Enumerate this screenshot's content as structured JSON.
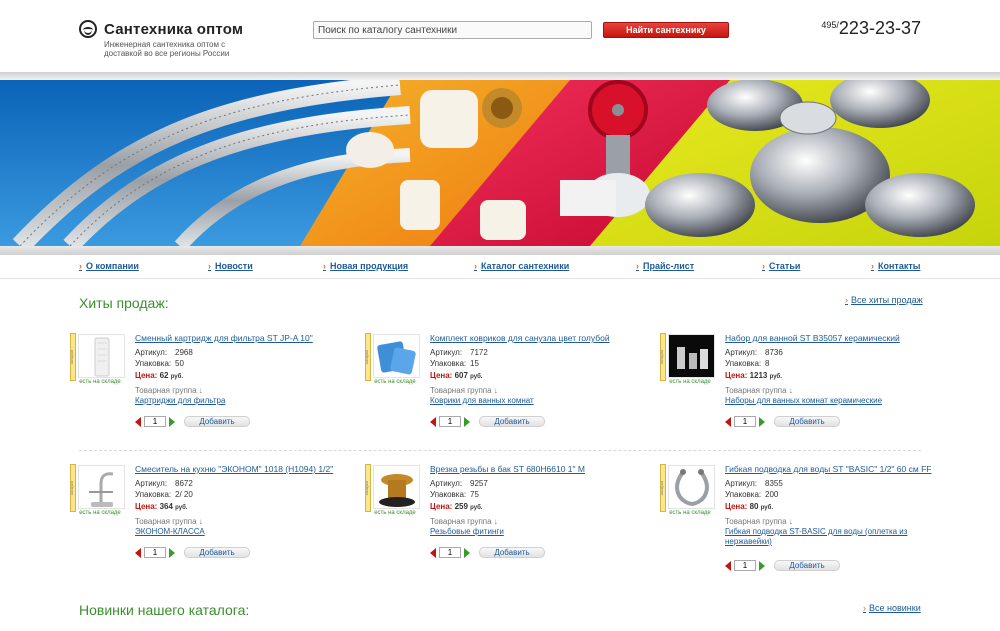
{
  "header": {
    "logo_title": "Сантехника оптом",
    "tagline": "Инженерная сантехника оптом с доставкой во все регионы России",
    "search_placeholder": "Поиск по каталогу сантехники",
    "search_button": "Найти сантехнику",
    "phone_code": "495/",
    "phone_number": "223-23-37"
  },
  "nav": [
    "О компании",
    "Новости",
    "Новая продукция",
    "Каталог сантехники",
    "Прайс-лист",
    "Статьи",
    "Контакты"
  ],
  "hits": {
    "title": "Хиты продаж:",
    "all_link": "Все хиты продаж"
  },
  "new": {
    "title": "Новинки нашего каталога:",
    "all_link": "Все новинки"
  },
  "labels": {
    "sku": "Артикул:",
    "pack": "Упаковка:",
    "price": "Цена:",
    "currency": "руб.",
    "group": "Товарная группа ↓",
    "in_stock": "есть на складе",
    "rating": "рейтинг",
    "add": "Добавить",
    "qty": "1"
  },
  "products": [
    {
      "name": "Сменный картридж для фильтра ST JP-A 10\"",
      "sku": "2968",
      "pack": "50",
      "price": "62",
      "group": "Картриджи для фильтра",
      "image": "filter-cartridge"
    },
    {
      "name": "Комплект ковриков для санузла цвет голубой",
      "sku": "7172",
      "pack": "15",
      "price": "607",
      "group": "Коврики для ванных комнат",
      "image": "bath-mats"
    },
    {
      "name": "Набор для ванной ST B35057 керамический",
      "sku": "8736",
      "pack": "8",
      "price": "1213",
      "group": "Наборы для ванных комнат керамические",
      "image": "bath-set"
    },
    {
      "name": "Смеситель на кухню \"ЭКОНОМ\" 1018 (Н1094) 1/2\"",
      "sku": "8672",
      "pack": "2/ 20",
      "price": "364",
      "group": "ЭКОНОМ-КЛАССА",
      "image": "kitchen-faucet"
    },
    {
      "name": "Врезка резьбы в бак ST 680Н6610 1\" М",
      "sku": "9257",
      "pack": "75",
      "price": "259",
      "group": "Резьбовые фитинги",
      "image": "brass-fitting"
    },
    {
      "name": "Гибкая подводка для воды ST \"BASIC\" 1/2\" 60 см FF",
      "sku": "8355",
      "pack": "200",
      "price": "80",
      "group": "Гибкая подводка ST-BASIC для воды (оплетка из нержавейки)",
      "image": "flexible-hose"
    }
  ],
  "colors": {
    "accent_green": "#3a8f2e",
    "link_blue": "#1e5a9a",
    "accent_red": "#c5150f"
  }
}
